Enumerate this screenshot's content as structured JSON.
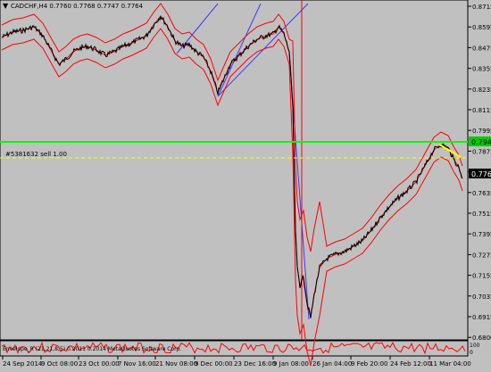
{
  "header": {
    "symbol_line": "CADCHF,H4  0.7760 0.7768 0.7747 0.7764",
    "collapse_icon": "triangle-down-icon"
  },
  "colors": {
    "background": "#c0c0c0",
    "price": "#000000",
    "bands": "#ff0000",
    "trendline": "#3a3aff",
    "horizontal_level": "#00ff00",
    "order_line": "#ffff00",
    "bid_label_bg": "#000000",
    "level_label_bg": "#00cc00"
  },
  "y_axis": {
    "ticks": [
      "0.8715",
      "0.8595",
      "0.8475",
      "0.8355",
      "0.8235",
      "0.8115",
      "0.7995",
      "0.7875",
      "0.7755",
      "0.7635",
      "0.7515",
      "0.7395",
      "0.7275",
      "0.7155",
      "0.7035",
      "0.6915",
      "0.6800"
    ]
  },
  "x_axis": {
    "ticks": [
      "24 Sep 2014",
      "9 Oct 08:00",
      "23 Oct 00:00",
      "7 Nov 16:00",
      "21 Nov 08:00",
      "9 Dec 00:00",
      "23 Dec 16:00",
      "9 Jan 08:00",
      "26 Jan 04:00",
      "9 Feb 20:00",
      "24 Feb 12:00",
      "11 Mar 04:00"
    ]
  },
  "levels": {
    "green_price": "0.7942",
    "bid_price": "0.7764",
    "order_label": "#5381632 sell 1.00"
  },
  "indicator": {
    "label": "Envelope_R (21,21,8,5) 0.2011 0.2014 MetaQuotes Software Corp.",
    "axis_top": "100",
    "axis_bottom": "0"
  }
}
